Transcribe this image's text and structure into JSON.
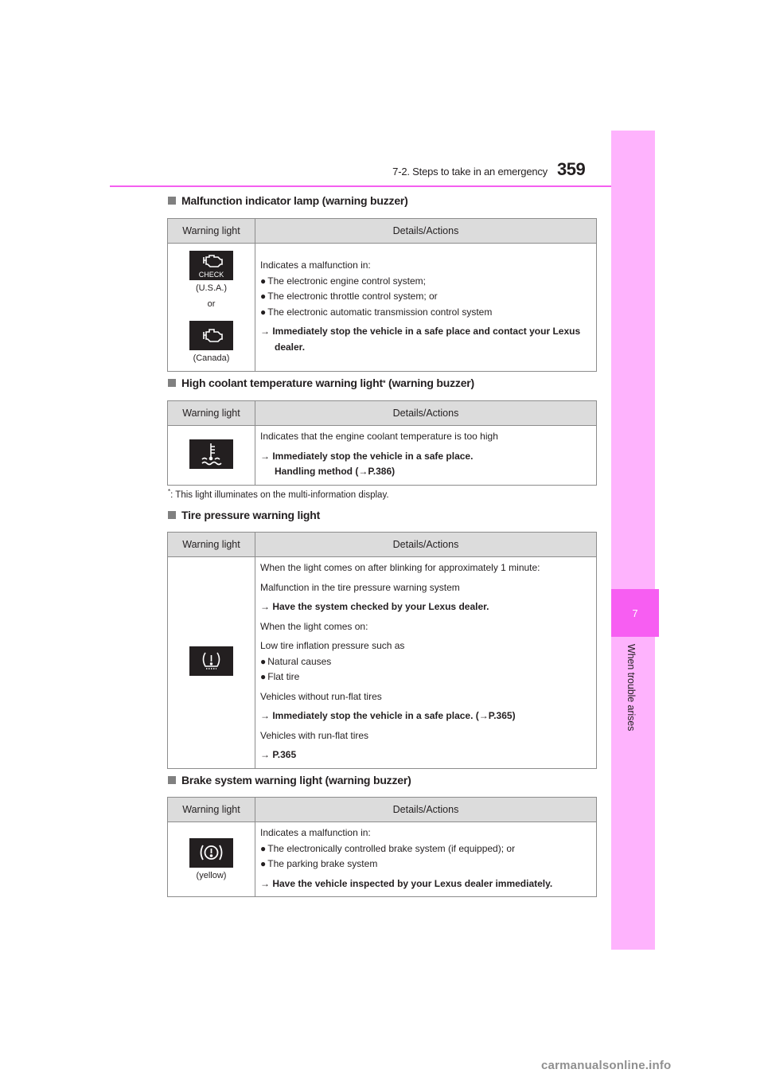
{
  "header": {
    "section_title": "7-2. Steps to take in an emergency",
    "page_number": "359"
  },
  "side_tab": {
    "chapter_number": "7",
    "chapter_title": "When trouble arises",
    "accent_color": "#f75ef2",
    "tab_color": "#feb3fd"
  },
  "table_headers": {
    "col1": "Warning light",
    "col2": "Details/Actions"
  },
  "sections": [
    {
      "title": "Malfunction indicator lamp (warning buzzer)",
      "icons": [
        {
          "name": "check-engine-icon",
          "text": "CHECK",
          "caption": "(U.S.A.)"
        },
        {
          "separator": "or"
        },
        {
          "name": "engine-icon",
          "caption": "(Canada)"
        }
      ],
      "intro": "Indicates a malfunction in:",
      "bullets": [
        "The electronic engine control system;",
        "The electronic throttle control system; or",
        "The electronic automatic transmission control system"
      ],
      "action_line1": "→ Immediately stop the vehicle in a safe place and contact your Lexus",
      "action_line2": "dealer."
    },
    {
      "title": "High coolant temperature warning light",
      "title_marker": "*",
      "title_suffix": " (warning buzzer)",
      "icon": "coolant-temperature-icon",
      "intro": "Indicates that the engine coolant temperature is too high",
      "action_line1": "→ Immediately stop the vehicle in a safe place.",
      "action_line2": "Handling method (→P.386)"
    },
    {
      "title": "Tire pressure warning light",
      "icon": "tire-pressure-icon",
      "lines": [
        {
          "text": "When the light comes on after blinking for approximately 1 minute:",
          "type": "normal"
        },
        {
          "text": "Malfunction in the tire pressure warning system",
          "type": "normal"
        },
        {
          "text": "→ Have the system checked by your Lexus dealer.",
          "type": "bold"
        },
        {
          "text": "When the light comes on:",
          "type": "normal"
        },
        {
          "text": "Low tire inflation pressure such as",
          "type": "normal"
        },
        {
          "text": "Natural causes",
          "type": "bullet"
        },
        {
          "text": "Flat tire",
          "type": "bullet"
        },
        {
          "text": "Vehicles without run-flat tires",
          "type": "normal"
        },
        {
          "text": "→ Immediately stop the vehicle in a safe place. (→P.365)",
          "type": "bold"
        },
        {
          "text": "Vehicles with run-flat tires",
          "type": "normal"
        },
        {
          "text": "→ P.365",
          "type": "bold"
        }
      ]
    },
    {
      "title": "Brake system warning light (warning buzzer)",
      "icon": "brake-system-icon",
      "icon_caption": "(yellow)",
      "intro": "Indicates a malfunction in:",
      "bullets": [
        "The electronically controlled brake system (if equipped); or",
        "The parking brake system"
      ],
      "action_line1": "→ Have the vehicle inspected by your Lexus dealer immediately."
    }
  ],
  "footnote": {
    "marker": "*",
    "text": ": This light illuminates on the multi-information display."
  },
  "watermark": "carmanualsonline.info"
}
